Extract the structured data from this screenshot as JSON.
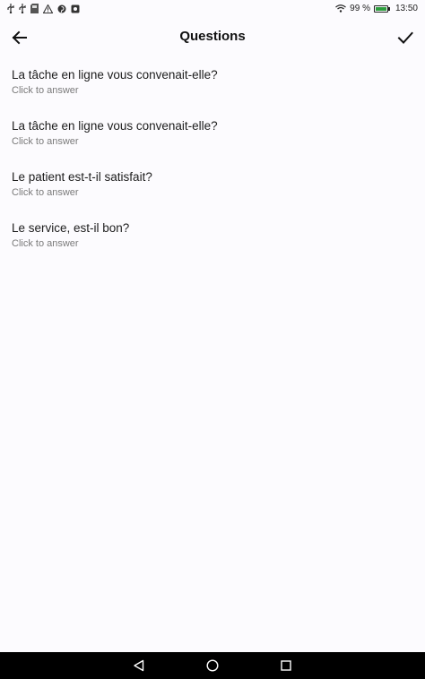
{
  "status_bar": {
    "battery_percent": "99 %",
    "battery_level": 0.99,
    "time": "13:50",
    "icons": [
      "usb-icon",
      "usb-icon",
      "sd-card-icon",
      "warning-icon",
      "pinterest-icon",
      "notification-icon",
      "wifi-icon",
      "battery-icon"
    ]
  },
  "app_bar": {
    "title": "Questions",
    "back_icon": "arrow-left-icon",
    "confirm_icon": "checkmark-icon"
  },
  "questions": [
    {
      "text": "La tâche en ligne vous convenait-elle?",
      "hint": "Click to answer"
    },
    {
      "text": "La tâche en ligne vous convenait-elle?",
      "hint": "Click to answer"
    },
    {
      "text": "Le patient est-t-il satisfait?",
      "hint": "Click to answer"
    },
    {
      "text": "Le service, est-il bon?",
      "hint": "Click to answer"
    }
  ],
  "nav_bar": {
    "icons": [
      "back-triangle-icon",
      "home-circle-icon",
      "recents-square-icon"
    ]
  }
}
